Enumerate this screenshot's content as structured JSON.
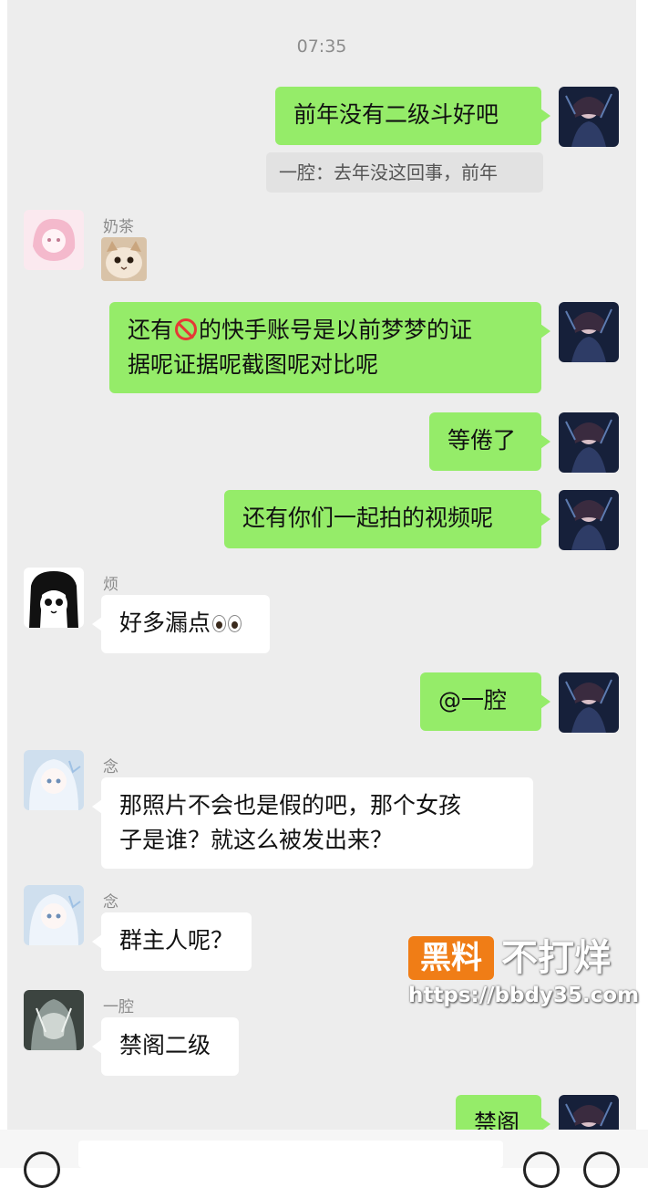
{
  "chat": {
    "timestamp": "07:35",
    "messages": [
      {
        "side": "right",
        "text": "前年没有二级斗好吧"
      },
      {
        "side": "right",
        "type": "quote",
        "text": "一腔：去年没这回事，前年"
      },
      {
        "side": "left",
        "sender": "奶茶",
        "type": "sticker",
        "sticker": "cat-face"
      },
      {
        "side": "right",
        "line1_before": "还有",
        "line1_after": "的快手账号是以前梦梦的证",
        "line2": "据呢证据呢截图呢对比呢",
        "inline_icon": "no-entry-icon"
      },
      {
        "side": "right",
        "text": "等倦了"
      },
      {
        "side": "right",
        "text": "还有你们一起拍的视频呢"
      },
      {
        "side": "left",
        "sender": "烦",
        "text": "好多漏点",
        "inline_icon": "eyes-emoji"
      },
      {
        "side": "right",
        "text": "@一腔"
      },
      {
        "side": "left",
        "sender": "念",
        "line1": "那照片不会也是假的吧，那个女孩",
        "line2": "子是谁？就这么被发出来？"
      },
      {
        "side": "left",
        "sender": "念",
        "text": "群主人呢？"
      },
      {
        "side": "left",
        "sender": "一腔",
        "text": "禁阁二级"
      },
      {
        "side": "right",
        "text": "禁阁"
      }
    ]
  },
  "watermark": {
    "badge": "黑料",
    "name": "不打烊",
    "url": "https://bbdy35.com"
  },
  "colors": {
    "chat_background": "#ededed",
    "my_bubble": "#95ec69",
    "other_bubble": "#ffffff",
    "watermark_orange": "#f07d16"
  },
  "icons": [
    "voice-icon",
    "emoji-icon",
    "plus-icon"
  ]
}
